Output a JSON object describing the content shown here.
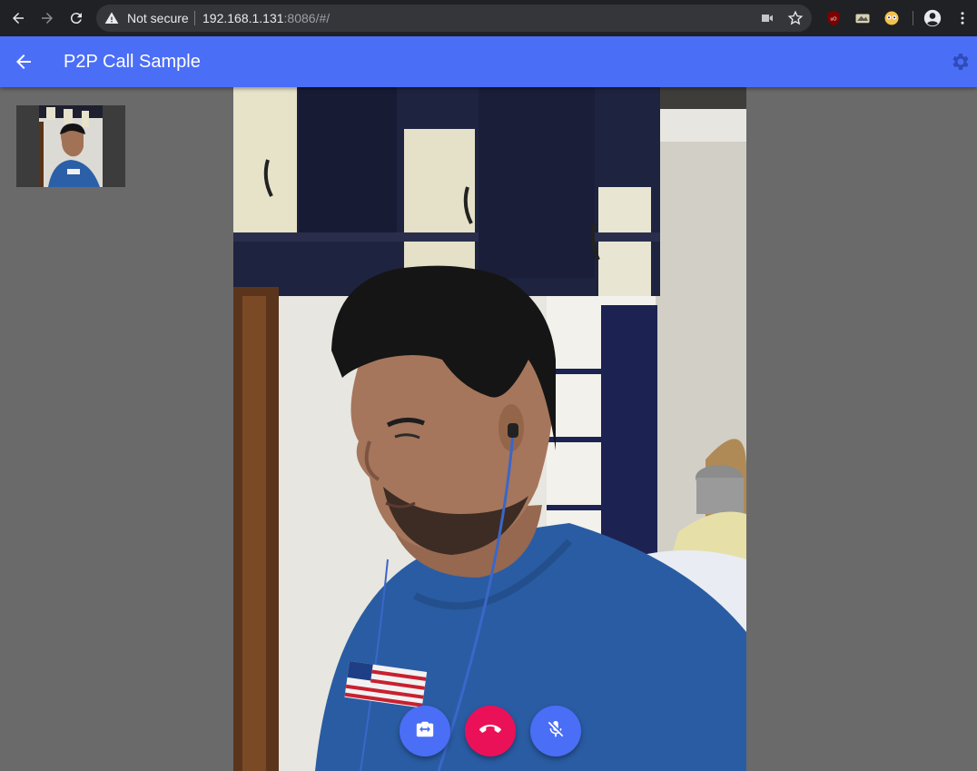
{
  "browser": {
    "security_label": "Not secure",
    "url_host": "192.168.1.131",
    "url_path": ":8086/#/",
    "icons": [
      "back-arrow-icon",
      "forward-arrow-icon",
      "reload-icon",
      "warning-icon",
      "camera-icon",
      "star-icon",
      "ublock-icon",
      "extension-icon",
      "extension-icon",
      "account-icon",
      "more-vert-icon"
    ]
  },
  "appbar": {
    "title": "P2P Call Sample",
    "back_icon": "arrow-back-icon",
    "settings_icon": "settings-gear-icon",
    "color": "#4b6ef7"
  },
  "controls": {
    "switch_camera_icon": "switch-camera-icon",
    "hangup_icon": "call-end-icon",
    "mute_icon": "mic-off-icon",
    "hangup_color": "#ea1159",
    "button_color": "#4b6ef7"
  }
}
